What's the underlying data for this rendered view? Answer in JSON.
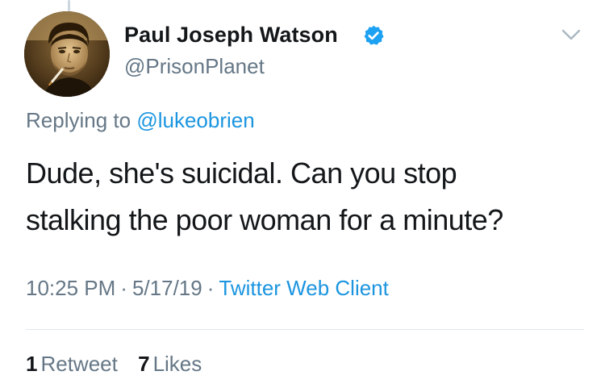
{
  "tweet": {
    "author": {
      "name": "Paul Joseph Watson",
      "handle": "@PrisonPlanet",
      "verified": true,
      "avatar_icon": "profile-photo"
    },
    "reply": {
      "prefix": "Replying to",
      "to_handle": "@lukeobrien"
    },
    "text_line1": "Dude, she's suicidal. Can you stop",
    "text_line2": "stalking the poor woman for a minute?",
    "meta": {
      "time": "10:25 PM",
      "separator": "·",
      "date": "5/17/19",
      "client": "Twitter Web Client"
    },
    "stats": {
      "retweets_count": "1",
      "retweets_label": "Retweet",
      "likes_count": "7",
      "likes_label": "Likes"
    }
  },
  "colors": {
    "link": "#1b95e0",
    "muted": "#657786",
    "text": "#14171a",
    "divider": "#e1e8ed",
    "verified": "#1da1f2"
  },
  "icons": {
    "verified": "verified-badge-icon",
    "menu": "chevron-down-icon"
  }
}
